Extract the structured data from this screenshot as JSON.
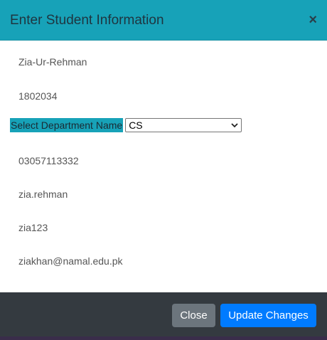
{
  "modal": {
    "title": "Enter Student Information",
    "close_icon": "×"
  },
  "form": {
    "name": "Zia-Ur-Rehman",
    "roll_no": "1802034",
    "department_label": "Select Department Name",
    "department_selected": "CS",
    "phone": "03057113332",
    "username": "zia.rehman",
    "password": "zia123",
    "email": "ziakhan@namal.edu.pk"
  },
  "footer": {
    "close_label": "Close",
    "update_label": "Update Changes"
  },
  "colors": {
    "header": "#17a2b8",
    "footer": "#343a40",
    "close_button": "#6c757d",
    "update_button": "#007bff"
  },
  "icons": {
    "close": "close-icon",
    "dropdown": "chevron-down-icon"
  }
}
